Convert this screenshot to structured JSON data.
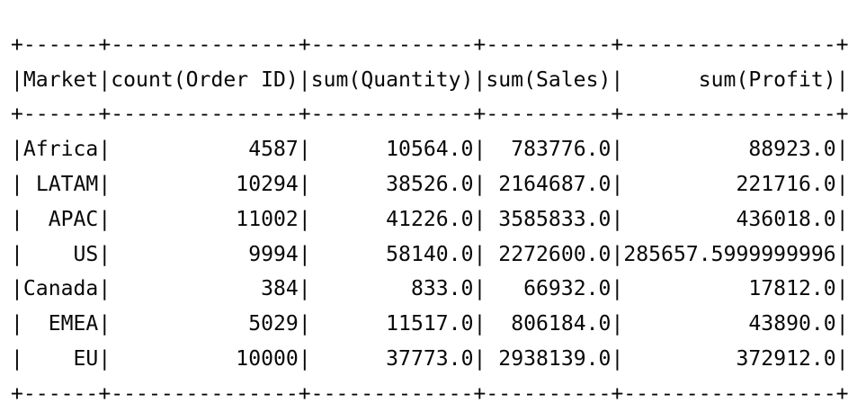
{
  "table": {
    "columns": [
      "Market",
      "count(Order ID)",
      "sum(Quantity)",
      "sum(Sales)",
      "sum(Profit)"
    ],
    "rows": [
      [
        "Africa",
        "4587",
        "10564.0",
        "783776.0",
        "88923.0"
      ],
      [
        "LATAM",
        "10294",
        "38526.0",
        "2164687.0",
        "221716.0"
      ],
      [
        "APAC",
        "11002",
        "41226.0",
        "3585833.0",
        "436018.0"
      ],
      [
        "US",
        "9994",
        "58140.0",
        "2272600.0",
        "285657.5999999996"
      ],
      [
        "Canada",
        "384",
        "833.0",
        "66932.0",
        "17812.0"
      ],
      [
        "EMEA",
        "5029",
        "11517.0",
        "806184.0",
        "43890.0"
      ],
      [
        "EU",
        "10000",
        "37773.0",
        "2938139.0",
        "372912.0"
      ]
    ]
  },
  "colors": {
    "text": "#080808",
    "background": "#ffffff"
  }
}
